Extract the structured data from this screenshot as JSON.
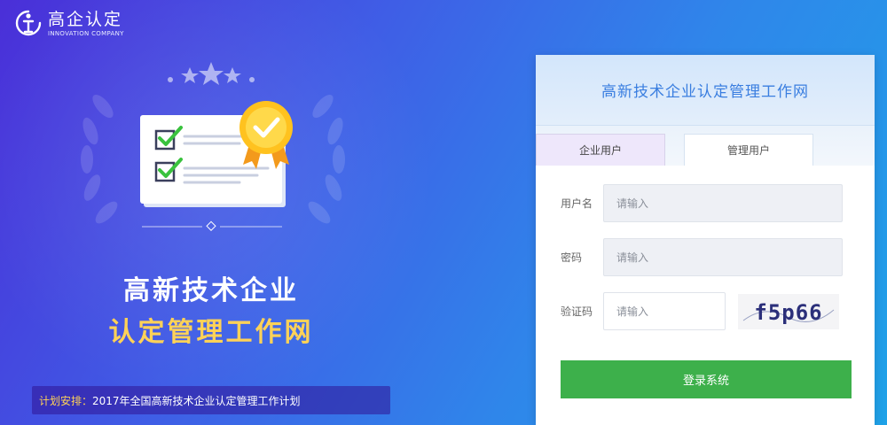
{
  "brand": {
    "logo_title": "高企认定",
    "logo_subtitle": "INNOVATION COMPANY",
    "logo_icon": "brand-logo-icon"
  },
  "hero": {
    "title_line1": "高新技术企业",
    "title_line2": "认定管理工作网",
    "illustration_icon": "certificate-checklist-icon"
  },
  "plan": {
    "label": "计划安排：",
    "text": "2017年全国高新技术企业认定管理工作计划"
  },
  "login": {
    "title": "高新技术企业认定管理工作网",
    "tabs": [
      {
        "label": "企业用户",
        "active": false
      },
      {
        "label": "管理用户",
        "active": true
      }
    ],
    "username": {
      "label": "用户名",
      "placeholder": "请输入"
    },
    "password": {
      "label": "密码",
      "placeholder": "请输入"
    },
    "captcha": {
      "label": "验证码",
      "placeholder": "请输入",
      "image_text": "f5p66"
    },
    "submit_label": "登录系统"
  },
  "colors": {
    "accent_yellow": "#ffd257",
    "login_button": "#3db04b",
    "card_title": "#3a7ee0"
  }
}
